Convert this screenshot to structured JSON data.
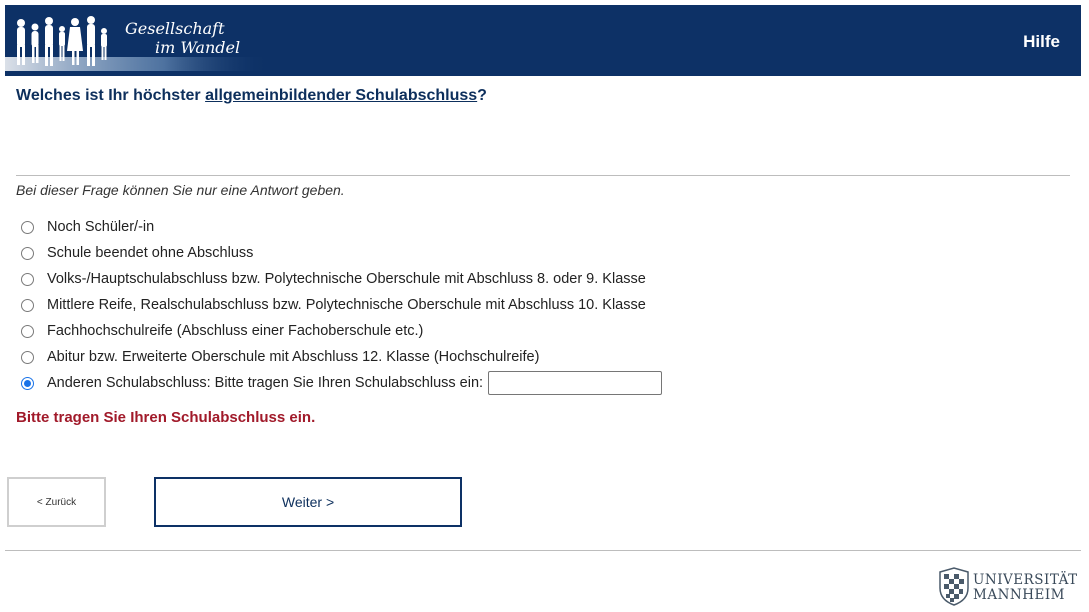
{
  "header": {
    "logo_line1": "Gesellschaft",
    "logo_line2": "im Wandel",
    "help_label": "Hilfe",
    "background_color": "#0d3166"
  },
  "question": {
    "prefix": "Welches ist Ihr höchster ",
    "term": "allgemeinbildender Schulabschluss",
    "suffix": "?"
  },
  "hint": "Bei dieser Frage können Sie nur eine Antwort geben.",
  "options": [
    {
      "label": "Noch Schüler/-in",
      "checked": false
    },
    {
      "label": "Schule beendet ohne Abschluss",
      "checked": false
    },
    {
      "label": "Volks-/Hauptschulabschluss bzw. Polytechnische Oberschule mit Abschluss 8. oder 9. Klasse",
      "checked": false
    },
    {
      "label": "Mittlere Reife, Realschulabschluss bzw. Polytechnische Oberschule mit Abschluss 10. Klasse",
      "checked": false
    },
    {
      "label": "Fachhochschulreife (Abschluss einer Fachoberschule etc.)",
      "checked": false
    },
    {
      "label": "Abitur bzw. Erweiterte Oberschule mit Abschluss 12. Klasse (Hochschulreife)",
      "checked": false
    },
    {
      "label": "Anderen Schulabschluss: Bitte tragen Sie Ihren Schulabschluss ein:",
      "checked": true
    }
  ],
  "other_input_value": "",
  "error_message": "Bitte tragen Sie Ihren Schulabschluss ein.",
  "error_color": "#a11a2a",
  "buttons": {
    "back_label": "< Zurück",
    "next_label": "Weiter >"
  },
  "footer": {
    "university_line1": "UNIVERSITÄT",
    "university_line2": "MANNHEIM"
  }
}
